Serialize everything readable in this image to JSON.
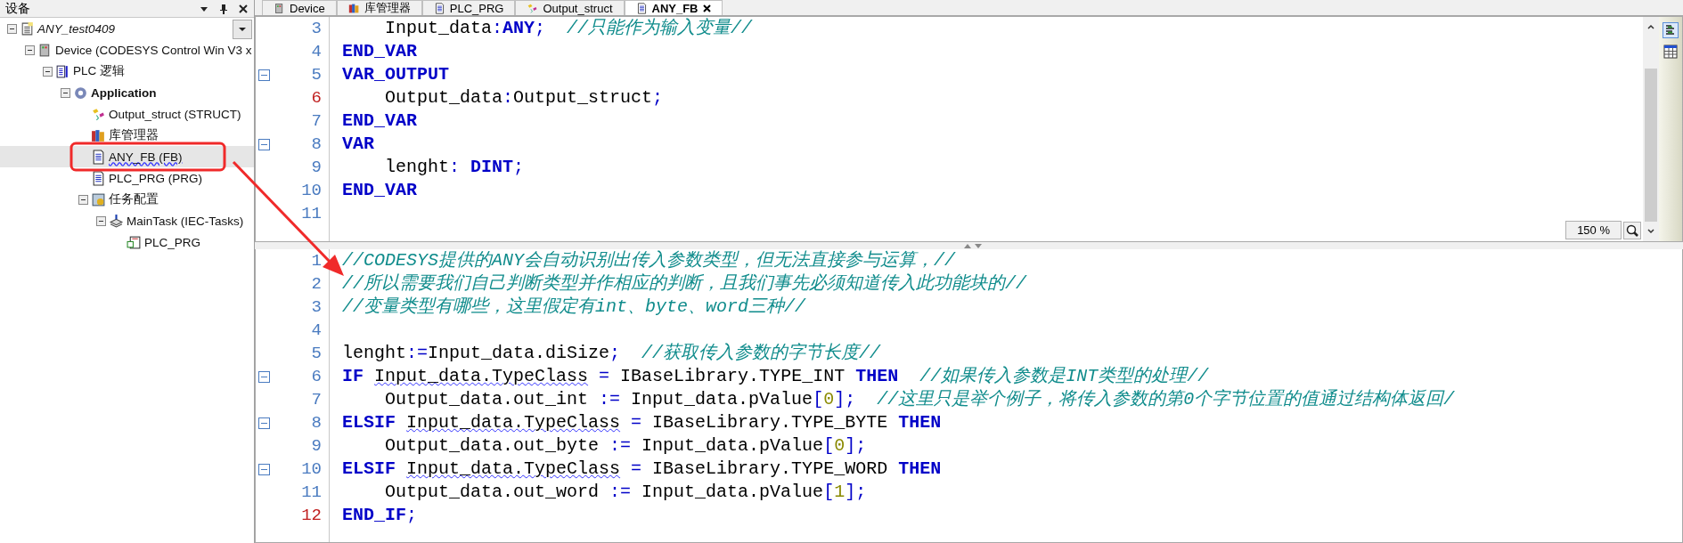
{
  "devices_panel": {
    "title": "设备"
  },
  "tree": [
    {
      "label": "ANY_test0409",
      "kind": "project",
      "expanded": true,
      "selected": false,
      "children": [
        {
          "label": "Device (CODESYS Control Win V3 x",
          "kind": "device",
          "expanded": true,
          "selected": false,
          "children": [
            {
              "label": "PLC 逻辑",
              "kind": "plc",
              "expanded": true,
              "selected": false,
              "children": [
                {
                  "label": "Application",
                  "kind": "application",
                  "active": true,
                  "expanded": true,
                  "selected": false,
                  "children": [
                    {
                      "label": "Output_struct (STRUCT)",
                      "kind": "struct",
                      "selected": false
                    },
                    {
                      "label": "库管理器",
                      "kind": "library",
                      "selected": false
                    },
                    {
                      "label": "ANY_FB (FB)",
                      "kind": "pou",
                      "selected": true,
                      "flagged": true
                    },
                    {
                      "label": "PLC_PRG (PRG)",
                      "kind": "pou",
                      "selected": false
                    },
                    {
                      "label": "任务配置",
                      "kind": "taskconfig",
                      "expanded": true,
                      "selected": false,
                      "children": [
                        {
                          "label": "MainTask (IEC-Tasks)",
                          "kind": "task",
                          "expanded": true,
                          "selected": false,
                          "children": [
                            {
                              "label": "PLC_PRG",
                              "kind": "call",
                              "selected": false
                            }
                          ]
                        }
                      ]
                    }
                  ]
                }
              ]
            }
          ]
        }
      ]
    }
  ],
  "tabs": [
    {
      "label": "Device",
      "kind": "device",
      "selected": false
    },
    {
      "label": "库管理器",
      "kind": "library",
      "selected": false
    },
    {
      "label": "PLC_PRG",
      "kind": "pou",
      "selected": false
    },
    {
      "label": "Output_struct",
      "kind": "struct",
      "selected": false
    },
    {
      "label": "ANY_FB",
      "kind": "pou",
      "selected": true
    }
  ],
  "declaration_editor": {
    "zoom": "150 %",
    "lines": [
      {
        "number": "3",
        "indented": true,
        "tokens": [
          {
            "kind": "code",
            "text": "Input_data:"
          },
          {
            "kind": "keyword",
            "text": "ANY"
          },
          {
            "kind": "code",
            "text": ";"
          },
          {
            "kind": "comment",
            "text": "  //只能作为输入变量//"
          }
        ]
      },
      {
        "number": "4",
        "tokens": [
          {
            "kind": "keyword",
            "text": "END_VAR"
          }
        ]
      },
      {
        "number": "5",
        "foldable": true,
        "tokens": [
          {
            "kind": "keyword",
            "text": "VAR_OUTPUT"
          }
        ]
      },
      {
        "number": "6",
        "changed": true,
        "indented": true,
        "tokens": [
          {
            "kind": "code",
            "text": "Output_data:Output_struct;"
          }
        ]
      },
      {
        "number": "7",
        "tokens": [
          {
            "kind": "keyword",
            "text": "END_VAR"
          }
        ]
      },
      {
        "number": "8",
        "foldable": true,
        "tokens": [
          {
            "kind": "keyword",
            "text": "VAR"
          }
        ]
      },
      {
        "number": "9",
        "indented": true,
        "tokens": [
          {
            "kind": "code",
            "text": "lenght: "
          },
          {
            "kind": "keyword",
            "text": "DINT"
          },
          {
            "kind": "code",
            "text": ";"
          }
        ]
      },
      {
        "number": "10",
        "tokens": [
          {
            "kind": "keyword",
            "text": "END_VAR"
          }
        ]
      },
      {
        "number": "11"
      }
    ]
  },
  "implementation_editor": {
    "lines": [
      {
        "number": "1",
        "tokens": [
          {
            "kind": "comment",
            "text": "//CODESYS提供的ANY会自动识别出传入参数类型，但无法直接参与运算，//"
          }
        ]
      },
      {
        "number": "2",
        "tokens": [
          {
            "kind": "comment",
            "text": "//所以需要我们自己判断类型并作相应的判断，且我们事先必须知道传入此功能块的//"
          }
        ]
      },
      {
        "number": "3",
        "tokens": [
          {
            "kind": "comment",
            "text": "//变量类型有哪些，这里假定有int、byte、word三种//"
          }
        ]
      },
      {
        "number": "4"
      },
      {
        "number": "5",
        "tokens": [
          {
            "kind": "code",
            "text": "lenght:=Input_data.diSize;"
          },
          {
            "kind": "comment",
            "text": "  //获取传入参数的字节长度//"
          }
        ]
      },
      {
        "number": "6",
        "foldable": true,
        "tokens": [
          {
            "kind": "keyword",
            "text": "IF "
          },
          {
            "kind": "flagged",
            "text": "Input_data.TypeClass"
          },
          {
            "kind": "code",
            "text": " = IBaseLibrary.TYPE_INT "
          },
          {
            "kind": "keyword",
            "text": "THEN"
          },
          {
            "kind": "comment",
            "text": "  //如果传入参数是INT类型的处理//"
          }
        ]
      },
      {
        "number": "7",
        "indented": true,
        "tokens": [
          {
            "kind": "code",
            "text": "Output_data.out_int := Input_data.pValue["
          },
          {
            "kind": "number",
            "text": "0"
          },
          {
            "kind": "code",
            "text": "];"
          },
          {
            "kind": "comment",
            "text": "  //这里只是举个例子，将传入参数的第0个字节位置的值通过结构体返回/"
          }
        ]
      },
      {
        "number": "8",
        "foldable": true,
        "tokens": [
          {
            "kind": "keyword",
            "text": "ELSIF "
          },
          {
            "kind": "flagged",
            "text": "Input_data.TypeClass"
          },
          {
            "kind": "code",
            "text": " = IBaseLibrary.TYPE_BYTE "
          },
          {
            "kind": "keyword",
            "text": "THEN"
          }
        ]
      },
      {
        "number": "9",
        "indented": true,
        "tokens": [
          {
            "kind": "code",
            "text": "Output_data.out_byte := Input_data.pValue["
          },
          {
            "kind": "number",
            "text": "0"
          },
          {
            "kind": "code",
            "text": "];"
          }
        ]
      },
      {
        "number": "10",
        "foldable": true,
        "tokens": [
          {
            "kind": "keyword",
            "text": "ELSIF "
          },
          {
            "kind": "flagged",
            "text": "Input_data.TypeClass"
          },
          {
            "kind": "code",
            "text": " = IBaseLibrary.TYPE_WORD "
          },
          {
            "kind": "keyword",
            "text": "THEN"
          }
        ]
      },
      {
        "number": "11",
        "indented": true,
        "tokens": [
          {
            "kind": "code",
            "text": "Output_data.out_word := Input_data.pValue["
          },
          {
            "kind": "number",
            "text": "1"
          },
          {
            "kind": "code",
            "text": "];"
          }
        ]
      },
      {
        "number": "12",
        "changed": true,
        "tokens": [
          {
            "kind": "keyword",
            "text": "END_IF"
          },
          {
            "kind": "code",
            "text": ";"
          }
        ]
      }
    ]
  }
}
